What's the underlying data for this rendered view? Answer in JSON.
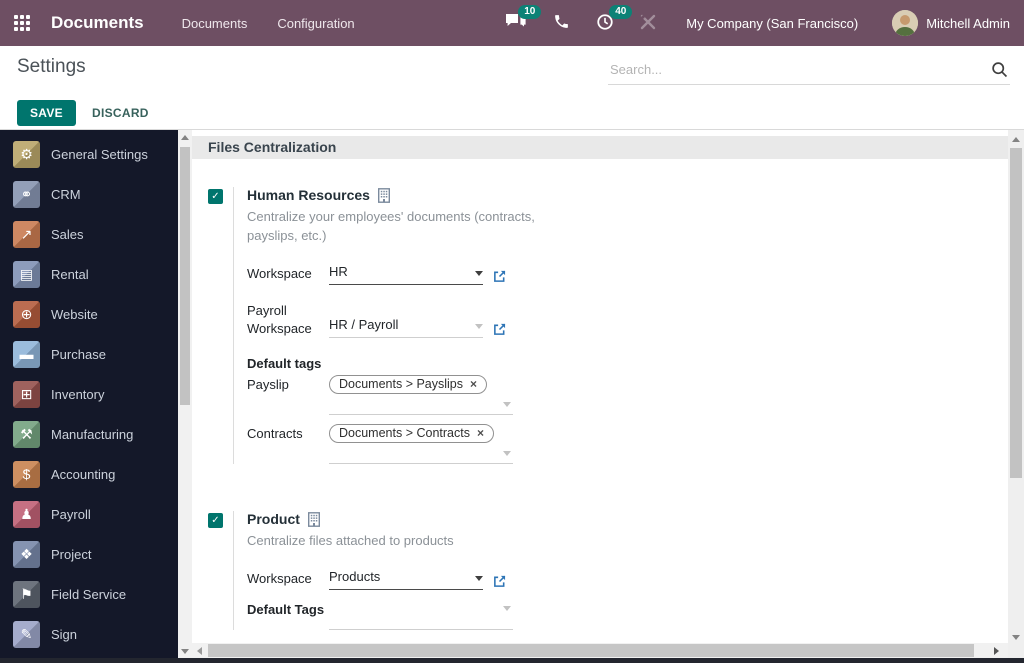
{
  "colors": {
    "topbar_bg": "#6e4f63",
    "accent_teal": "#00756d",
    "badge_teal": "#0c8276",
    "sidebar_bg": "#141829",
    "link_blue": "#2e75b6"
  },
  "topbar": {
    "app_name": "Documents",
    "menus": [
      {
        "label": "Documents"
      },
      {
        "label": "Configuration"
      }
    ],
    "messages": {
      "icon": "chat-icon",
      "badge": "10"
    },
    "phone": {
      "icon": "phone-icon"
    },
    "activities": {
      "icon": "activity-clock-icon",
      "badge": "40"
    },
    "tools": {
      "icon": "tools-icon"
    },
    "company": "My Company (San Francisco)",
    "user": "Mitchell Admin"
  },
  "control_panel": {
    "title": "Settings",
    "save_label": "SAVE",
    "discard_label": "DISCARD",
    "search": {
      "placeholder": "Search...",
      "icon": "search-icon"
    }
  },
  "sidebar": {
    "items": [
      {
        "label": "General Settings",
        "icon": "gear-icon",
        "color": "#b9a569"
      },
      {
        "label": "CRM",
        "icon": "handshake-icon",
        "color": "#8794b0"
      },
      {
        "label": "Sales",
        "icon": "chart-icon",
        "color": "#c97b51"
      },
      {
        "label": "Rental",
        "icon": "rental-card-icon",
        "color": "#8091b4"
      },
      {
        "label": "Website",
        "icon": "globe-icon",
        "color": "#b35c3d"
      },
      {
        "label": "Purchase",
        "icon": "credit-card-icon",
        "color": "#90b4d8"
      },
      {
        "label": "Inventory",
        "icon": "box-icon",
        "color": "#94504c"
      },
      {
        "label": "Manufacturing",
        "icon": "wrench-icon",
        "color": "#74a27f"
      },
      {
        "label": "Accounting",
        "icon": "invoice-icon",
        "color": "#c8824f"
      },
      {
        "label": "Payroll",
        "icon": "employee-icon",
        "color": "#c06075"
      },
      {
        "label": "Project",
        "icon": "puzzle-icon",
        "color": "#7787a8"
      },
      {
        "label": "Field Service",
        "icon": "truck-icon",
        "color": "#5d6470"
      },
      {
        "label": "Sign",
        "icon": "pen-icon",
        "color": "#9ba3c6"
      }
    ]
  },
  "main": {
    "section_title": "Files Centralization",
    "hr": {
      "checked": true,
      "title": "Human Resources",
      "title_icon": "building-icon",
      "description": "Centralize your employees' documents (contracts, payslips, etc.)",
      "workspace_label": "Workspace",
      "workspace_value": "HR",
      "payroll_workspace_label": "Payroll Workspace",
      "payroll_workspace_value": "HR / Payroll",
      "default_tags_label": "Default tags",
      "payslip_label": "Payslip",
      "payslip_tag": "Documents > Payslips",
      "contracts_label": "Contracts",
      "contracts_tag": "Documents > Contracts"
    },
    "product": {
      "checked": true,
      "title": "Product",
      "title_icon": "building-icon",
      "description": "Centralize files attached to products",
      "workspace_label": "Workspace",
      "workspace_value": "Products",
      "default_tags_label": "Default Tags"
    }
  }
}
